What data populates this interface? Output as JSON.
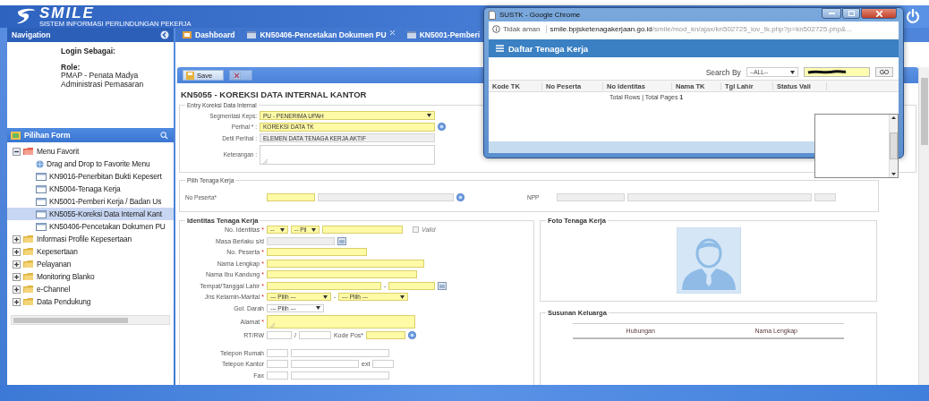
{
  "header": {
    "logo": "SMILE",
    "tagline": "SISTEM INFORMASI PERLINDUNGAN PEKERJA"
  },
  "navigation": {
    "title": "Navigation",
    "login_label": "Login Sebagai:",
    "role_label": "Role:",
    "role": "PMAP - Penata Madya Administrasi Pemasaran"
  },
  "form_panel": {
    "title": "Pilihan Form",
    "tree": [
      {
        "label": "Menu Favorit",
        "kind": "favorites",
        "expanded": true,
        "selected": false,
        "children": [
          {
            "label": "Drag and Drop to Favorite Menu",
            "kind": "hint",
            "selected": false
          },
          {
            "label": "KN9016-Penerbitan Bukti Kepesert",
            "kind": "form",
            "selected": false
          },
          {
            "label": "KN5004-Tenaga Kerja",
            "kind": "form",
            "selected": false
          },
          {
            "label": "KN5001-Pemberi Kerja / Badan Us",
            "kind": "form",
            "selected": false
          },
          {
            "label": "KN5055-Koreksi Data Internal Kant",
            "kind": "form",
            "selected": true
          },
          {
            "label": "KN50406-Pencetakan Dokumen PU",
            "kind": "form",
            "selected": false
          }
        ]
      },
      {
        "label": "Informasi Profile Kepesertaan",
        "kind": "folder",
        "expanded": false,
        "selected": false
      },
      {
        "label": "Kepesertaan",
        "kind": "folder",
        "expanded": false,
        "selected": false
      },
      {
        "label": "Pelayanan",
        "kind": "folder",
        "expanded": false,
        "selected": false
      },
      {
        "label": "Monitoring Blanko",
        "kind": "folder",
        "expanded": false,
        "selected": false
      },
      {
        "label": "e-Channel",
        "kind": "folder",
        "expanded": false,
        "selected": false
      },
      {
        "label": "Data Pendukung",
        "kind": "folder",
        "expanded": false,
        "selected": false
      }
    ]
  },
  "tabs": [
    {
      "label": "Dashboard",
      "kind": "home",
      "closable": false
    },
    {
      "label": "KN50406-Pencetakan Dokumen PU",
      "kind": "form",
      "closable": true
    },
    {
      "label": "KN5001-Pemberi",
      "kind": "form",
      "closable": false
    }
  ],
  "toolbar": [
    {
      "kind": "save",
      "label": "Save",
      "disabled": false
    },
    {
      "kind": "clear",
      "disabled": true
    }
  ],
  "page_title": "KN5055 - KOREKSI DATA INTERNAL KANTOR",
  "entry_section": {
    "legend": "Entry Koreksi Data Internal",
    "rows": [
      {
        "label": "Segmentasi Keps:",
        "parts": [
          {
            "kind": "select",
            "value": "PU - PENERIMA UPAH",
            "required": true,
            "readonly": false
          }
        ]
      },
      {
        "label": "Perihal * :",
        "parts": [
          {
            "kind": "input",
            "value": "KOREKSI DATA TK",
            "required": true,
            "readonly": false
          },
          {
            "kind": "help"
          }
        ]
      },
      {
        "label": "Detil Perihal :",
        "parts": [
          {
            "kind": "input",
            "value": "ELEMEN DATA TENAGA KERJA AKTIF",
            "required": false,
            "readonly": true
          }
        ]
      },
      {
        "label": "Keterangan :",
        "parts": [
          {
            "kind": "textarea",
            "required": false,
            "readonly": false
          }
        ]
      }
    ]
  },
  "worker_pick_section": {
    "legend": "Pilih Tenaga Kerja",
    "groups": [
      {
        "label": "No Peserta*",
        "parts": [
          {
            "kind": "input",
            "required": true,
            "readonly": false
          },
          {
            "kind": "input",
            "required": false,
            "readonly": true
          },
          {
            "kind": "help"
          }
        ]
      },
      {
        "label": "NPP",
        "parts": [
          {
            "kind": "input",
            "required": false,
            "readonly": true
          },
          {
            "kind": "input",
            "required": false,
            "readonly": true
          },
          {
            "kind": "input",
            "required": false,
            "readonly": true
          }
        ]
      }
    ]
  },
  "identity_section": {
    "legend": "Identitas Tenaga Kerja",
    "rows": [
      {
        "label": "No. Identitas",
        "mark": "*",
        "parts": [
          {
            "kind": "select",
            "value": "--",
            "required": true,
            "readonly": false
          },
          {
            "kind": "select",
            "value": "-- Pil",
            "required": true,
            "readonly": false
          },
          {
            "kind": "input",
            "required": true,
            "readonly": false
          },
          {
            "kind": "checkbox",
            "label": "Valid",
            "checked": false
          }
        ]
      },
      {
        "label": "Masa Berlaku s/d",
        "parts": [
          {
            "kind": "input",
            "required": false,
            "readonly": true
          },
          {
            "kind": "calendar"
          }
        ]
      },
      {
        "label": "No. Peserta",
        "mark": "*",
        "parts": [
          {
            "kind": "input",
            "required": true,
            "readonly": false
          }
        ]
      },
      {
        "label": "Nama Lengkap",
        "mark": "*",
        "parts": [
          {
            "kind": "input",
            "required": true,
            "readonly": false
          }
        ]
      },
      {
        "label": "Nama Ibu Kandung",
        "mark": "*",
        "parts": [
          {
            "kind": "input",
            "required": true,
            "readonly": false
          }
        ]
      },
      {
        "label": "Tempat/Tanggal Lahir",
        "mark": "*",
        "parts": [
          {
            "kind": "input",
            "required": true,
            "readonly": false
          },
          {
            "kind": "text",
            "text": "-"
          },
          {
            "kind": "input",
            "required": true,
            "readonly": false
          },
          {
            "kind": "calendar"
          }
        ]
      },
      {
        "label": "Jns Kelamin-Marital",
        "mark": "*",
        "parts": [
          {
            "kind": "select",
            "value": "--- Pilih ---",
            "required": true,
            "readonly": false
          },
          {
            "kind": "text",
            "text": "-"
          },
          {
            "kind": "select",
            "value": "--- Pilih ---",
            "required": true,
            "readonly": false
          }
        ]
      },
      {
        "label": "Gol. Darah",
        "parts": [
          {
            "kind": "select",
            "value": "--- Pilih ---",
            "required": false,
            "readonly": false
          }
        ]
      },
      {
        "label": "Alamat",
        "mark": "*",
        "parts": [
          {
            "kind": "textarea",
            "required": true,
            "readonly": false
          }
        ]
      },
      {
        "label": "RT/RW",
        "parts": [
          {
            "kind": "input",
            "required": false,
            "readonly": false
          },
          {
            "kind": "text",
            "text": "/"
          },
          {
            "kind": "input",
            "required": false,
            "readonly": false
          },
          {
            "kind": "text",
            "text": "Kode Pos*"
          },
          {
            "kind": "input",
            "required": true,
            "readonly": false
          },
          {
            "kind": "help"
          }
        ]
      },
      {
        "label": "Telepon Rumah",
        "parts": [
          {
            "kind": "input",
            "required": false,
            "readonly": false
          },
          {
            "kind": "input",
            "required": false,
            "readonly": false
          }
        ]
      },
      {
        "label": "Telepon Kantor",
        "parts": [
          {
            "kind": "input",
            "required": false,
            "readonly": false
          },
          {
            "kind": "input",
            "required": false,
            "readonly": false
          },
          {
            "kind": "text",
            "text": "ext"
          },
          {
            "kind": "input",
            "required": false,
            "readonly": false
          }
        ]
      },
      {
        "label": "Fax",
        "parts": [
          {
            "kind": "input",
            "required": false,
            "readonly": false
          },
          {
            "kind": "input",
            "required": false,
            "readonly": false
          }
        ]
      }
    ]
  },
  "photo_section": {
    "legend": "Foto Tenaga Kerja"
  },
  "family_section": {
    "legend": "Susunan Keluarga",
    "columns": [
      "Hubungan",
      "Nama Lengkap"
    ]
  },
  "popup": {
    "window_title": "SUSTK - Google Chrome",
    "security": "Tidak aman",
    "url_host": "smile.bpjsketenagakerjaan.go.id",
    "url_path": "/smile/mod_kn/ajax/kn502725_lov_tk.php?p=kn502725.php&...",
    "panel_title": "Daftar Tenaga Kerja",
    "search_label": "Search By",
    "search_select": "--ALL--",
    "go_button": "GO",
    "columns": [
      "Kode TK",
      "No Peserta",
      "No Identitas",
      "Nama TK",
      "Tgl Lahir",
      "Status Vali"
    ],
    "footer": "Total Rows | Total Pages **1**"
  }
}
